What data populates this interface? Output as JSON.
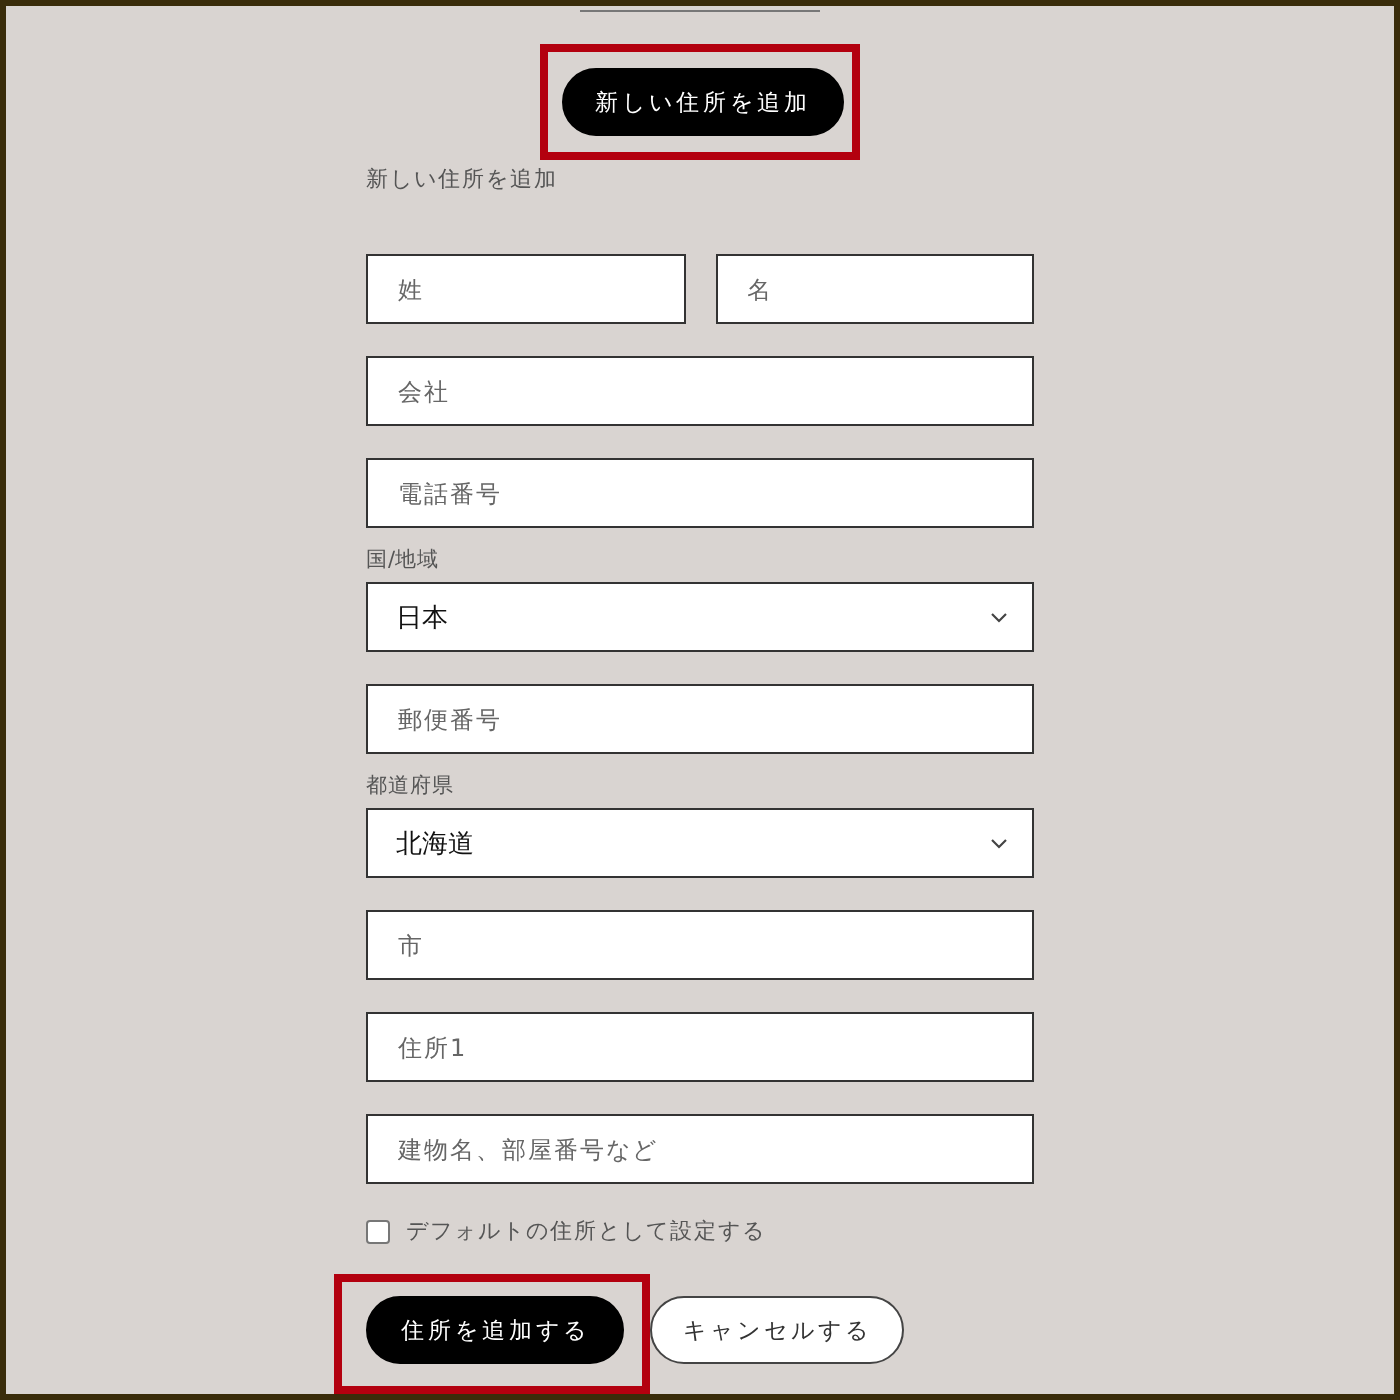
{
  "top_button": {
    "label": "新しい住所を追加",
    "highlighted": true
  },
  "form_title": "新しい住所を追加",
  "name_row": [
    {
      "kind": "text",
      "placeholder": "姓"
    },
    {
      "kind": "text",
      "placeholder": "名"
    }
  ],
  "fields": [
    {
      "kind": "text",
      "placeholder": "会社"
    },
    {
      "kind": "text",
      "placeholder": "電話番号"
    },
    {
      "kind": "select",
      "label": "国/地域",
      "value": "日本"
    },
    {
      "kind": "text",
      "placeholder": "郵便番号"
    },
    {
      "kind": "select",
      "label": "都道府県",
      "value": "北海道"
    },
    {
      "kind": "text",
      "placeholder": "市"
    },
    {
      "kind": "text",
      "placeholder": "住所1"
    },
    {
      "kind": "text",
      "placeholder": "建物名、部屋番号など"
    }
  ],
  "default_checkbox": {
    "label": "デフォルトの住所として設定する",
    "checked": false
  },
  "actions": [
    {
      "kind": "primary",
      "label": "住所を追加する",
      "highlighted": true
    },
    {
      "kind": "secondary",
      "label": "キャンセルする",
      "highlighted": false
    }
  ]
}
